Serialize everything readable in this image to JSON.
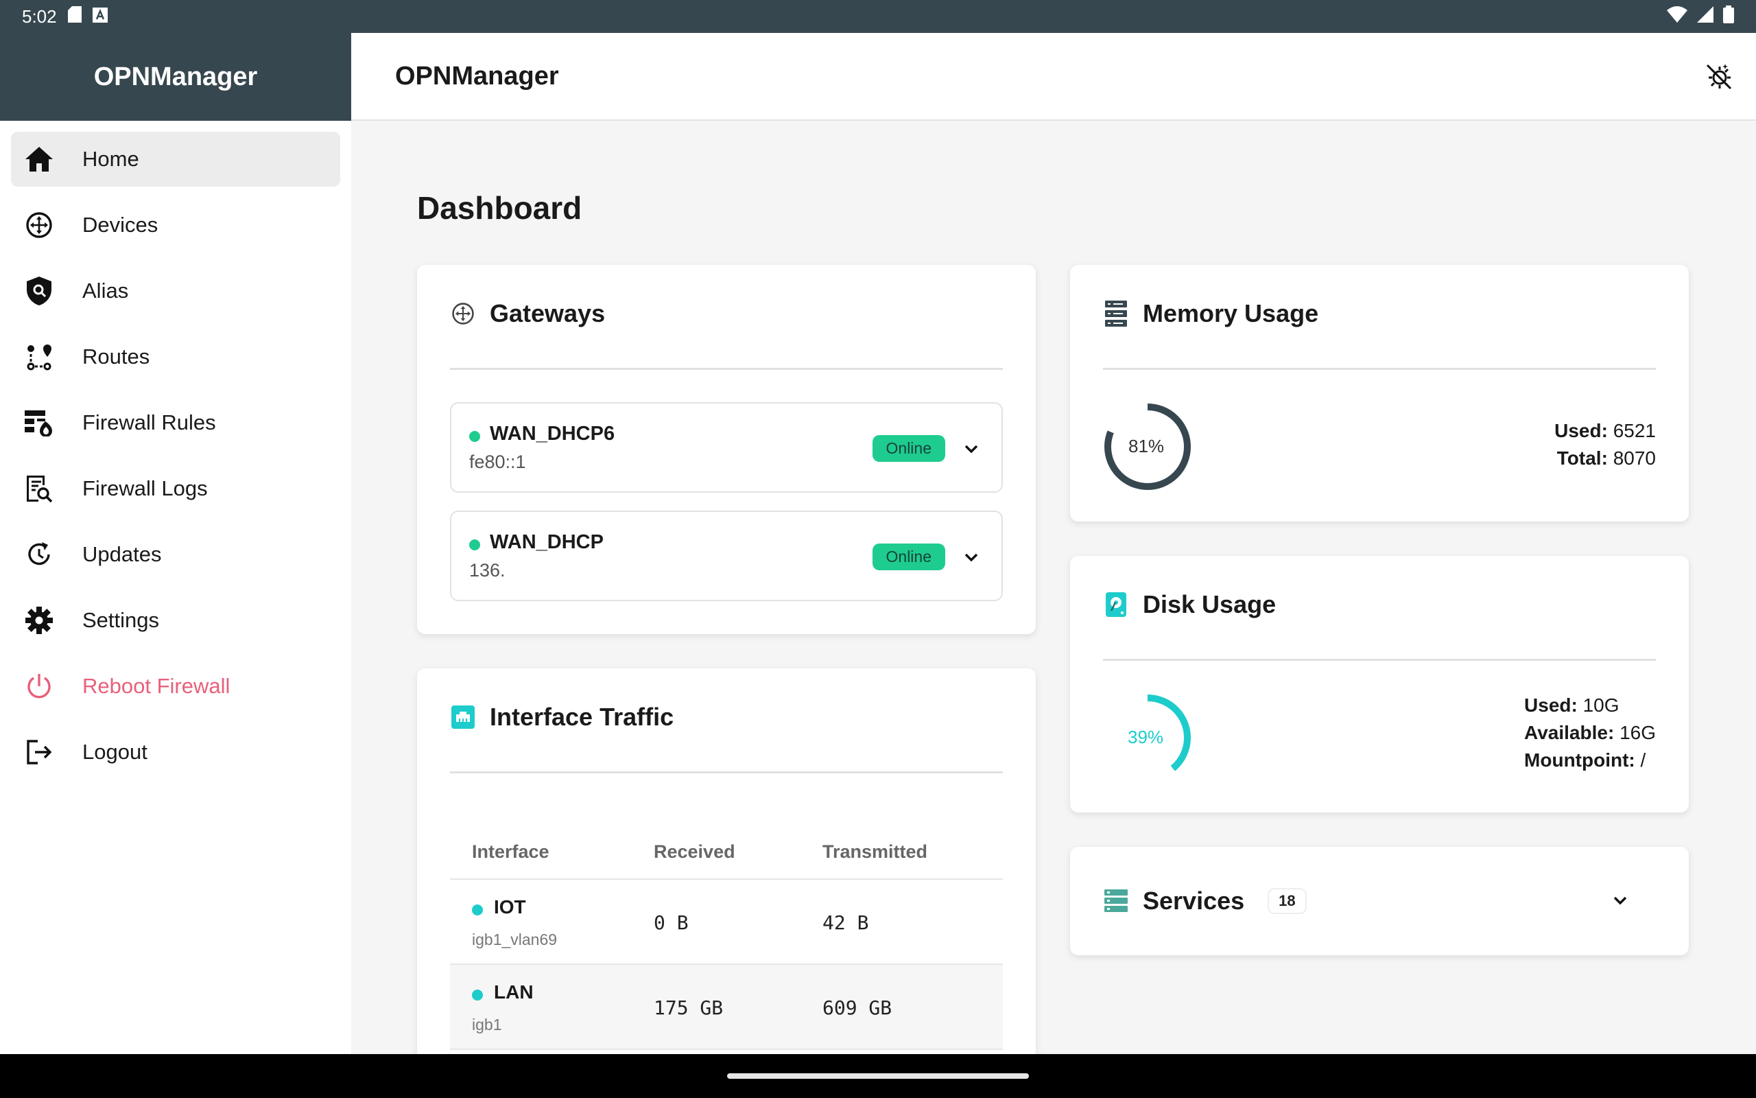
{
  "status_bar": {
    "time": "5:02"
  },
  "sidebar": {
    "app_name": "OPNManager",
    "items": [
      {
        "label": "Home",
        "icon": "home-icon"
      },
      {
        "label": "Devices",
        "icon": "hub-icon"
      },
      {
        "label": "Alias",
        "icon": "shield-search-icon"
      },
      {
        "label": "Routes",
        "icon": "route-icon"
      },
      {
        "label": "Firewall Rules",
        "icon": "firewall-icon"
      },
      {
        "label": "Firewall Logs",
        "icon": "log-search-icon"
      },
      {
        "label": "Updates",
        "icon": "update-icon"
      },
      {
        "label": "Settings",
        "icon": "gear-icon"
      },
      {
        "label": "Reboot Firewall",
        "icon": "power-icon"
      },
      {
        "label": "Logout",
        "icon": "logout-icon"
      }
    ]
  },
  "appbar": {
    "title": "OPNManager"
  },
  "page": {
    "title": "Dashboard"
  },
  "gateways": {
    "title": "Gateways",
    "items": [
      {
        "name": "WAN_DHCP6",
        "address": "fe80::1",
        "status": "Online"
      },
      {
        "name": "WAN_DHCP",
        "address": "136.",
        "status": "Online"
      }
    ]
  },
  "traffic": {
    "title": "Interface Traffic",
    "columns": [
      "Interface",
      "Received",
      "Transmitted"
    ],
    "rows": [
      {
        "name": "IOT",
        "device": "igb1_vlan69",
        "received": "0 B",
        "transmitted": "42 B"
      },
      {
        "name": "LAN",
        "device": "igb1",
        "received": "175 GB",
        "transmitted": "609 GB"
      }
    ]
  },
  "memory": {
    "title": "Memory Usage",
    "percent_label": "81%",
    "percent": 81,
    "used_label": "Used:",
    "used": "6521",
    "total_label": "Total:",
    "total": "8070",
    "color": "#37474f"
  },
  "disk": {
    "title": "Disk Usage",
    "percent_label": "39%",
    "percent": 39,
    "used_label": "Used:",
    "used": "10G",
    "available_label": "Available:",
    "available": "16G",
    "mountpoint_label": "Mountpoint:",
    "mountpoint": "/",
    "color": "#1ecccc"
  },
  "services": {
    "title": "Services",
    "count": "18"
  },
  "colors": {
    "online": "#1ecc8f",
    "teal": "#1ecccc",
    "danger": "#e8607a",
    "header": "#37474f"
  }
}
